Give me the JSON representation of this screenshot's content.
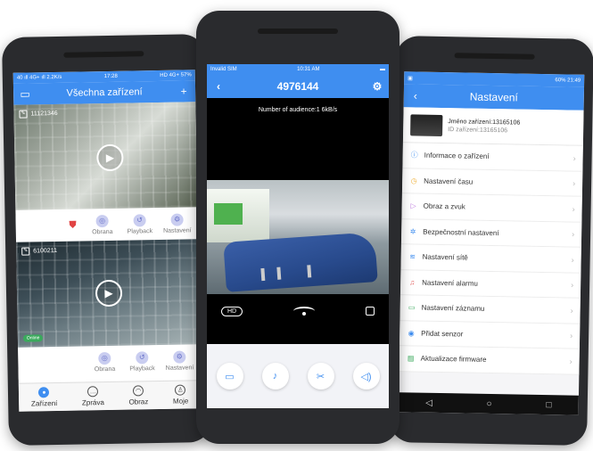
{
  "phone1": {
    "status": {
      "left": "40 ıll 4G+ ıll 2.2K/s",
      "time": "17:28",
      "right": "HD 4G+ 57%"
    },
    "header": {
      "title": "Všechna zařízení",
      "left_icon": "scan-icon",
      "right_icon": "plus-icon",
      "plus": "+"
    },
    "cameras": [
      {
        "id": "11121346",
        "online": "",
        "actions": [
          "Obrana",
          "Playback",
          "Nastavení"
        ]
      },
      {
        "id": "6100211",
        "online": "Online",
        "actions": [
          "Obrana",
          "Playback",
          "Nastavení"
        ]
      }
    ],
    "tabs": [
      "Zařízení",
      "Zpráva",
      "Obraz",
      "Moje"
    ]
  },
  "phone2": {
    "status": {
      "left": "Invalid SIM",
      "time": "10:31 AM"
    },
    "header": {
      "title": "4976144"
    },
    "audience": "Number of audience:1   6kB/s",
    "hd": "HD"
  },
  "phone3": {
    "status": {
      "time": "60% 21:49"
    },
    "header": {
      "title": "Nastavení"
    },
    "device": {
      "name": "Jméno zařízení:13165106",
      "id": "ID zařízení:13165106"
    },
    "menu": [
      {
        "label": "Informace o zařízení",
        "icon": "info-icon",
        "color": "#3f8ef0"
      },
      {
        "label": "Nastavení času",
        "icon": "clock-icon",
        "color": "#f0b33f"
      },
      {
        "label": "Obraz a zvuk",
        "icon": "media-icon",
        "color": "#c07ee0"
      },
      {
        "label": "Bezpečnostní nastavení",
        "icon": "security-icon",
        "color": "#3f8ef0"
      },
      {
        "label": "Nastavení sítě",
        "icon": "wifi-icon",
        "color": "#3f8ef0"
      },
      {
        "label": "Nastavení alarmu",
        "icon": "bell-icon",
        "color": "#e25b5b"
      },
      {
        "label": "Nastavení záznamu",
        "icon": "record-icon",
        "color": "#3aaa5c"
      },
      {
        "label": "Přidat senzor",
        "icon": "sensor-icon",
        "color": "#3f8ef0"
      },
      {
        "label": "Aktualizace firmware",
        "icon": "upgrade-icon",
        "color": "#3aaa5c"
      }
    ]
  },
  "colors": {
    "accent": "#3f8ef0",
    "online": "#3aaa5c",
    "alert": "#e14444"
  }
}
